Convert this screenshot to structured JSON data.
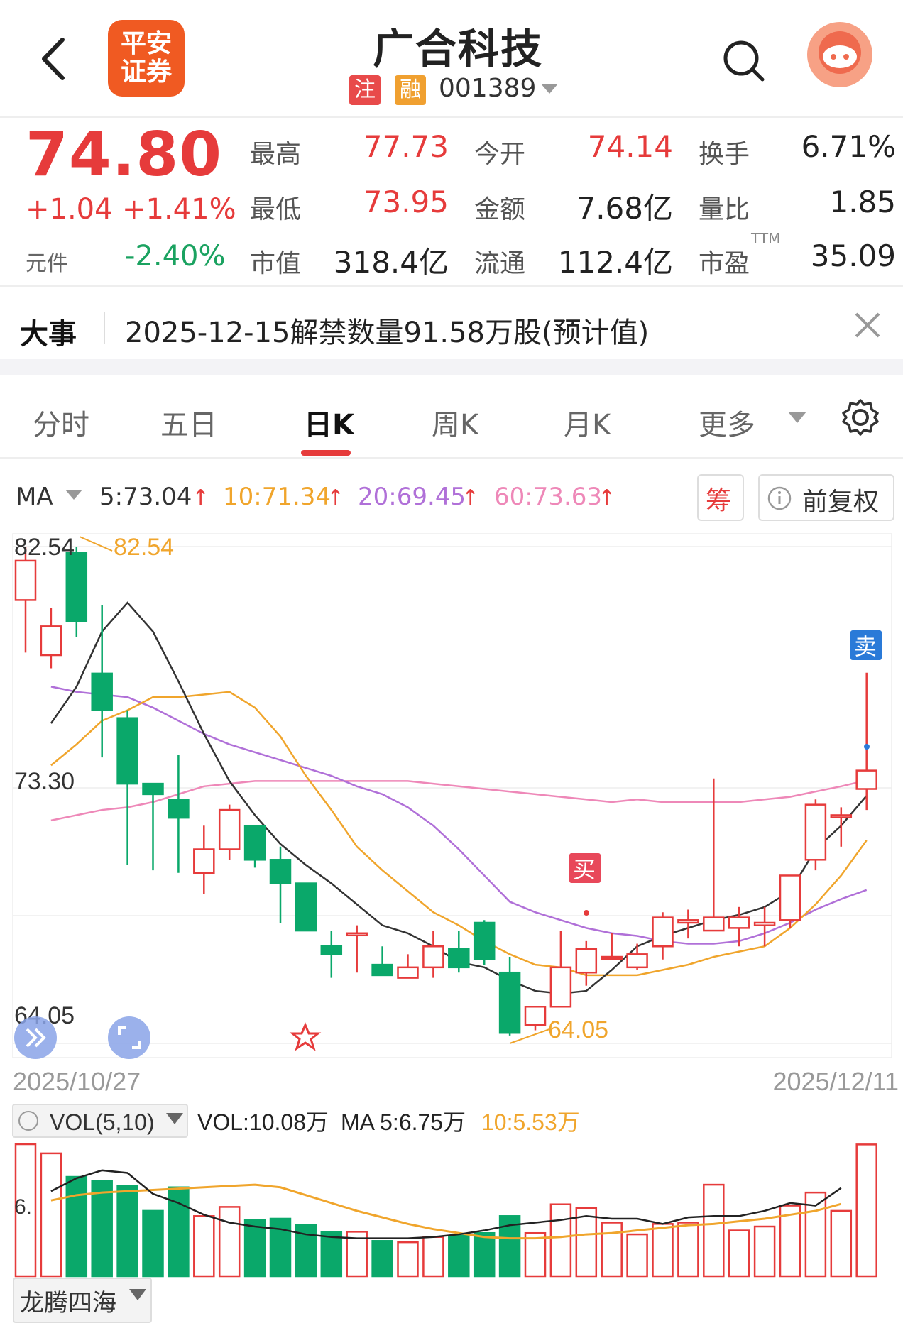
{
  "header": {
    "title": "广合科技",
    "logo_text": "平安证券",
    "tag_registration": "注",
    "tag_margin": "融",
    "stock_code": "001389"
  },
  "quote": {
    "price": "74.80",
    "change_abs": "+1.04",
    "change_pct": "+1.41%",
    "unit_label": "元件",
    "unit_change": "-2.40%",
    "stats": [
      {
        "label": "最高",
        "value": "77.73"
      },
      {
        "label": "今开",
        "value": "74.14"
      },
      {
        "label": "换手",
        "value": "6.71%"
      },
      {
        "label": "最低",
        "value": "73.95"
      },
      {
        "label": "金额",
        "value": "7.68亿"
      },
      {
        "label": "量比",
        "value": "1.85"
      },
      {
        "label": "市值",
        "value": "318.4亿"
      },
      {
        "label": "流通",
        "value": "112.4亿"
      },
      {
        "label": "市盈",
        "value": "35.09"
      }
    ],
    "ttm_label": "TTM"
  },
  "event": {
    "label": "大事",
    "text": "2025-12-15解禁数量91.58万股(预计值)"
  },
  "tabs": [
    "分时",
    "五日",
    "日K",
    "周K",
    "月K",
    "更多"
  ],
  "active_tab": "日K",
  "ma": {
    "label": "MA",
    "ma5": "5:73.04",
    "ma10": "10:71.34",
    "ma20": "20:69.45",
    "ma60": "60:73.63",
    "chip_label": "筹",
    "adjust_label": "前复权"
  },
  "colors": {
    "up": "#e63b3b",
    "down": "#0aa86a",
    "ma5": "#333333",
    "ma10": "#f0a52c",
    "ma20": "#b070d8",
    "ma60": "#ee88b8"
  },
  "chart_data": {
    "type": "candlestick",
    "y_high_label": "82.54",
    "y_mid_label": "73.30",
    "y_low_label": "64.05",
    "max_marker": "82.54",
    "min_marker": "64.05",
    "start_date": "2025/10/27",
    "end_date": "2025/12/11",
    "buy_marker": "买",
    "sell_marker": "卖",
    "ylim": [
      64.05,
      82.54
    ],
    "candles": [
      [
        80.5,
        82.0,
        78.5,
        82.54
      ],
      [
        78.4,
        79.5,
        77.9,
        80.2
      ],
      [
        82.3,
        79.7,
        79.1,
        82.54
      ],
      [
        77.7,
        76.3,
        74.5,
        80.3
      ],
      [
        76.0,
        73.5,
        70.4,
        76.3
      ],
      [
        73.5,
        73.1,
        70.2,
        73.5
      ],
      [
        72.9,
        72.2,
        70.1,
        74.6
      ],
      [
        70.1,
        71.0,
        69.3,
        71.9
      ],
      [
        71.0,
        72.5,
        70.6,
        72.7
      ],
      [
        71.9,
        70.6,
        70.3,
        71.9
      ],
      [
        70.6,
        69.7,
        68.2,
        71.1
      ],
      [
        69.7,
        67.9,
        67.9,
        69.7
      ],
      [
        67.3,
        67.0,
        66.1,
        67.9
      ],
      [
        67.8,
        67.8,
        66.3,
        68.1
      ],
      [
        66.6,
        66.2,
        66.2,
        67.3
      ],
      [
        66.1,
        66.5,
        66.1,
        67.0
      ],
      [
        66.5,
        67.3,
        66.1,
        67.9
      ],
      [
        67.2,
        66.5,
        66.3,
        67.9
      ],
      [
        68.2,
        66.8,
        66.6,
        68.3
      ],
      [
        66.3,
        64.0,
        63.9,
        66.9
      ],
      [
        64.3,
        65.0,
        64.1,
        65.0
      ],
      [
        65.0,
        66.5,
        65.0,
        67.9
      ],
      [
        66.3,
        67.2,
        65.8,
        67.5
      ],
      [
        66.9,
        66.9,
        66.8,
        67.8
      ],
      [
        66.5,
        67.0,
        66.4,
        67.4
      ],
      [
        67.3,
        68.4,
        66.8,
        68.6
      ],
      [
        68.2,
        68.3,
        67.6,
        68.7
      ],
      [
        67.9,
        68.4,
        67.9,
        73.7
      ],
      [
        68.0,
        68.4,
        67.3,
        68.8
      ],
      [
        68.1,
        68.2,
        67.3,
        68.8
      ],
      [
        68.3,
        70.0,
        68.0,
        70.0
      ],
      [
        70.6,
        72.7,
        70.2,
        72.9
      ],
      [
        72.3,
        72.3,
        71.1,
        72.6
      ],
      [
        73.3,
        74.0,
        72.5,
        77.73
      ]
    ],
    "ma_series": {
      "ma5": [
        75.8,
        77.2,
        79.3,
        80.4,
        79.3,
        77.4,
        75.4,
        73.6,
        72.3,
        71.2,
        70.4,
        69.7,
        68.9,
        68.1,
        67.8,
        67.3,
        66.7,
        66.5,
        66.0,
        65.6,
        65.5,
        65.6,
        66.4,
        67.3,
        67.7,
        68.0,
        68.3,
        68.5,
        68.8,
        69.4,
        71.0,
        71.9,
        73.04
      ],
      "ma10": [
        74.2,
        75.0,
        75.9,
        76.3,
        76.8,
        76.8,
        76.9,
        77.0,
        76.4,
        75.3,
        73.8,
        72.5,
        71.1,
        70.2,
        69.4,
        68.6,
        68.1,
        67.5,
        67.0,
        66.6,
        66.5,
        66.2,
        66.2,
        66.2,
        66.4,
        66.6,
        66.9,
        67.1,
        67.3,
        68.0,
        68.9,
        70.0,
        71.34
      ],
      "ma20": [
        77.2,
        77.0,
        76.9,
        76.8,
        76.4,
        75.9,
        75.4,
        75.0,
        74.7,
        74.4,
        74.1,
        73.8,
        73.4,
        73.1,
        72.6,
        71.9,
        71.0,
        70.0,
        69.0,
        68.6,
        68.3,
        68.0,
        67.8,
        67.7,
        67.5,
        67.4,
        67.4,
        67.5,
        67.8,
        68.2,
        68.7,
        69.1,
        69.45
      ],
      "ma60": [
        72.1,
        72.3,
        72.5,
        72.6,
        72.8,
        73.1,
        73.4,
        73.5,
        73.6,
        73.6,
        73.6,
        73.6,
        73.6,
        73.6,
        73.6,
        73.5,
        73.4,
        73.3,
        73.2,
        73.1,
        73.0,
        72.9,
        72.8,
        72.9,
        72.8,
        72.8,
        72.8,
        72.8,
        72.9,
        73.0,
        73.2,
        73.4,
        73.63
      ]
    }
  },
  "volume": {
    "label": "VOL(5,10)",
    "vol": "VOL:10.08万",
    "ma5": "MA 5:6.75万",
    "ma10": "10:5.53万",
    "axis_label": "6.",
    "bars": [
      10.1,
      9.4,
      7.6,
      7.3,
      6.9,
      5.0,
      6.8,
      4.6,
      5.3,
      4.3,
      4.4,
      3.9,
      3.4,
      3.4,
      2.7,
      2.6,
      3.0,
      3.1,
      3.3,
      4.6,
      3.3,
      5.5,
      5.2,
      4.1,
      3.2,
      4.0,
      4.1,
      7.0,
      3.5,
      3.8,
      5.4,
      6.4,
      5.0,
      10.08
    ],
    "ma5_line": [
      6.5,
      7.5,
      8.1,
      7.9,
      6.3,
      5.6,
      4.7,
      4.1,
      3.8,
      3.6,
      3.2,
      3.0,
      2.9,
      2.9,
      2.9,
      3.0,
      3.2,
      3.5,
      3.9,
      4.1,
      4.3,
      4.6,
      4.4,
      4.4,
      4.0,
      4.5,
      4.6,
      4.6,
      5.0,
      5.6,
      5.4,
      6.75
    ],
    "ma10_line": [
      5.8,
      6.2,
      6.4,
      6.5,
      6.6,
      6.7,
      6.8,
      6.9,
      7.0,
      6.8,
      6.2,
      5.6,
      5.0,
      4.5,
      4.0,
      3.6,
      3.3,
      3.0,
      2.9,
      2.9,
      3.0,
      3.2,
      3.3,
      3.5,
      3.7,
      3.9,
      4.0,
      4.2,
      4.4,
      4.7,
      5.0,
      5.53
    ],
    "bottom_label": "龙腾四海"
  }
}
